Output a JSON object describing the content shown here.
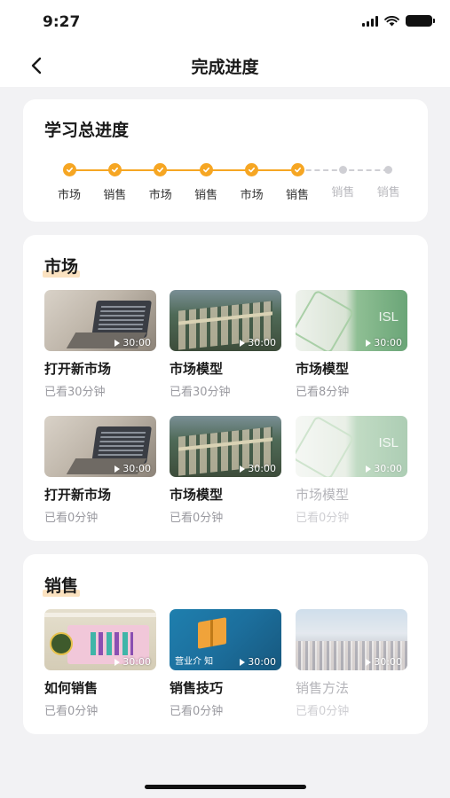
{
  "status_bar": {
    "time": "9:27"
  },
  "nav": {
    "title": "完成进度"
  },
  "overall_progress": {
    "title": "学习总进度",
    "completed_steps": 6,
    "steps": [
      {
        "label": "市场",
        "done": true
      },
      {
        "label": "销售",
        "done": true
      },
      {
        "label": "市场",
        "done": true
      },
      {
        "label": "销售",
        "done": true
      },
      {
        "label": "市场",
        "done": true
      },
      {
        "label": "销售",
        "done": true
      },
      {
        "label": "销售",
        "done": false
      },
      {
        "label": "销售",
        "done": false
      }
    ]
  },
  "market_section": {
    "title": "市场",
    "courses": [
      {
        "name": "打开新市场",
        "watched": "已看30分钟",
        "duration": "30:00",
        "thumb": "laptop",
        "faded": false
      },
      {
        "name": "市场模型",
        "watched": "已看30分钟",
        "duration": "30:00",
        "thumb": "city",
        "faded": false
      },
      {
        "name": "市场模型",
        "watched": "已看8分钟",
        "duration": "30:00",
        "thumb": "green",
        "thumb_text": "ISL",
        "faded": false
      },
      {
        "name": "打开新市场",
        "watched": "已看0分钟",
        "duration": "30:00",
        "thumb": "laptop",
        "faded": false
      },
      {
        "name": "市场模型",
        "watched": "已看0分钟",
        "duration": "30:00",
        "thumb": "city",
        "faded": false
      },
      {
        "name": "市场模型",
        "watched": "已看0分钟",
        "duration": "30:00",
        "thumb": "green",
        "thumb_text": "ISL",
        "faded": true
      }
    ]
  },
  "sales_section": {
    "title": "销售",
    "courses": [
      {
        "name": "如何销售",
        "watched": "已看0分钟",
        "duration": "30:00",
        "thumb": "pink",
        "faded": false
      },
      {
        "name": "销售技巧",
        "watched": "已看0分钟",
        "duration": "30:00",
        "thumb": "blue",
        "thumb_text": "营业介    知",
        "faded": false
      },
      {
        "name": "销售方法",
        "watched": "已看0分钟",
        "duration": "30:00",
        "thumb": "crowd",
        "faded": true
      }
    ]
  },
  "colors": {
    "accent": "#f6a623",
    "highlight": "#fbe2c0",
    "pending": "#cfcfd4",
    "background": "#f2f2f4"
  }
}
